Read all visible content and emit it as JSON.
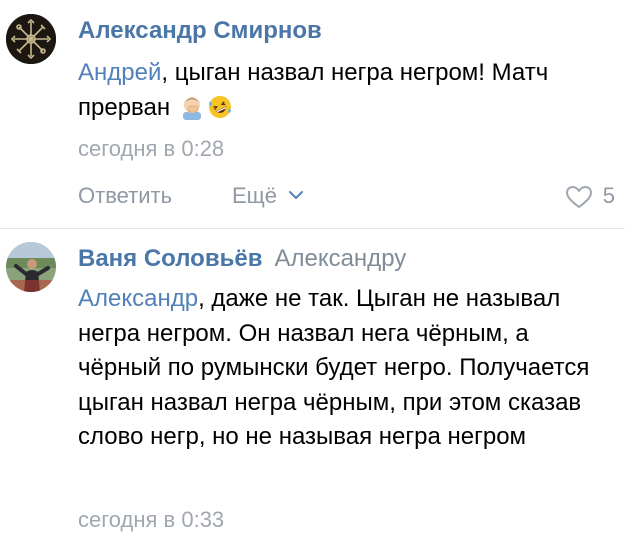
{
  "comments": [
    {
      "author": "Александр Смирнов",
      "reply_to": "",
      "mention": "Андрей",
      "text": ", цыган назвал негра негром! Матч прерван",
      "emojis": [
        "man-facepalming-emoji",
        "rolling-on-floor-laughing-emoji"
      ],
      "timestamp": "сегодня в 0:28",
      "actions": {
        "reply_label": "Ответить",
        "more_label": "Ещё",
        "like_count": "5"
      }
    },
    {
      "author": "Ваня Соловьёв",
      "reply_to": "Александру",
      "mention": "Александр",
      "text": ", даже не так. Цыган не называл негра негром. Он назвал нега чёрным, а чёрный по румынски будет негро. Получается цыган назвал негра чёрным, при этом сказав слово негр, но не называя негра негром",
      "timestamp": "сегодня в 0:33"
    }
  ],
  "colors": {
    "author": "#4a76a8",
    "mention": "#5181b8",
    "secondary": "#818c99",
    "timestamp": "#a0a7b0",
    "divider": "#e7e8ec"
  }
}
